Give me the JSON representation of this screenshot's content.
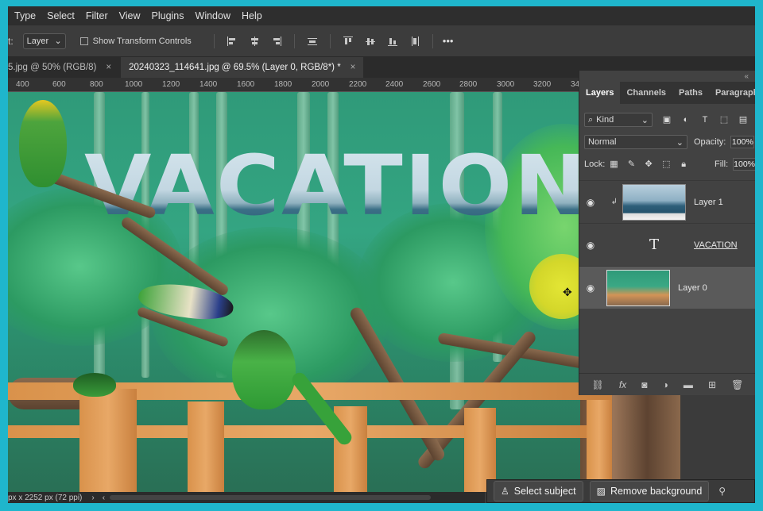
{
  "menu": [
    "Type",
    "Select",
    "Filter",
    "View",
    "Plugins",
    "Window",
    "Help"
  ],
  "options": {
    "prefix": "t:",
    "auto_select_value": "Layer",
    "show_transform_label": "Show Transform Controls",
    "more_label": "•••"
  },
  "tabs": [
    {
      "label": "5.jpg @ 50% (RGB/8)",
      "close": "×"
    },
    {
      "label": "20240323_114641.jpg @ 69.5% (Layer 0, RGB/8*) *",
      "close": "×"
    }
  ],
  "ruler": [
    "400",
    "600",
    "800",
    "1000",
    "1200",
    "1400",
    "1600",
    "1800",
    "2000",
    "2200",
    "2400",
    "2600",
    "2800",
    "3000",
    "3200",
    "34"
  ],
  "canvas": {
    "text_layer": "VACATION"
  },
  "panel": {
    "collapse": "«",
    "tabs": [
      "Layers",
      "Channels",
      "Paths",
      "Paragraph"
    ],
    "filter_kind": "Kind",
    "blend_mode": "Normal",
    "opacity_label": "Opacity:",
    "opacity_value": "100%",
    "lock_label": "Lock:",
    "fill_label": "Fill:",
    "fill_value": "100%",
    "layers": [
      {
        "name": "Layer 1",
        "type": "image",
        "visible": true,
        "selected": false
      },
      {
        "name": "VACATION",
        "type": "text",
        "visible": true,
        "selected": false
      },
      {
        "name": "Layer 0",
        "type": "image",
        "visible": true,
        "selected": true
      }
    ],
    "footer_icons": [
      "link-icon",
      "fx-icon",
      "mask-icon",
      "adjustment-icon",
      "folder-icon",
      "new-layer-icon",
      "trash-icon"
    ]
  },
  "status": {
    "doc_info": "px x 2252 px (72 ppi)",
    "arrow": "›",
    "scroll_left": "‹"
  },
  "context_bar": {
    "select_subject": "Select subject",
    "remove_background": "Remove background"
  },
  "colors": {
    "frame": "#1fb6cc",
    "highlight": "#d9dc2b",
    "selected_layer": "#5a5a5a"
  }
}
